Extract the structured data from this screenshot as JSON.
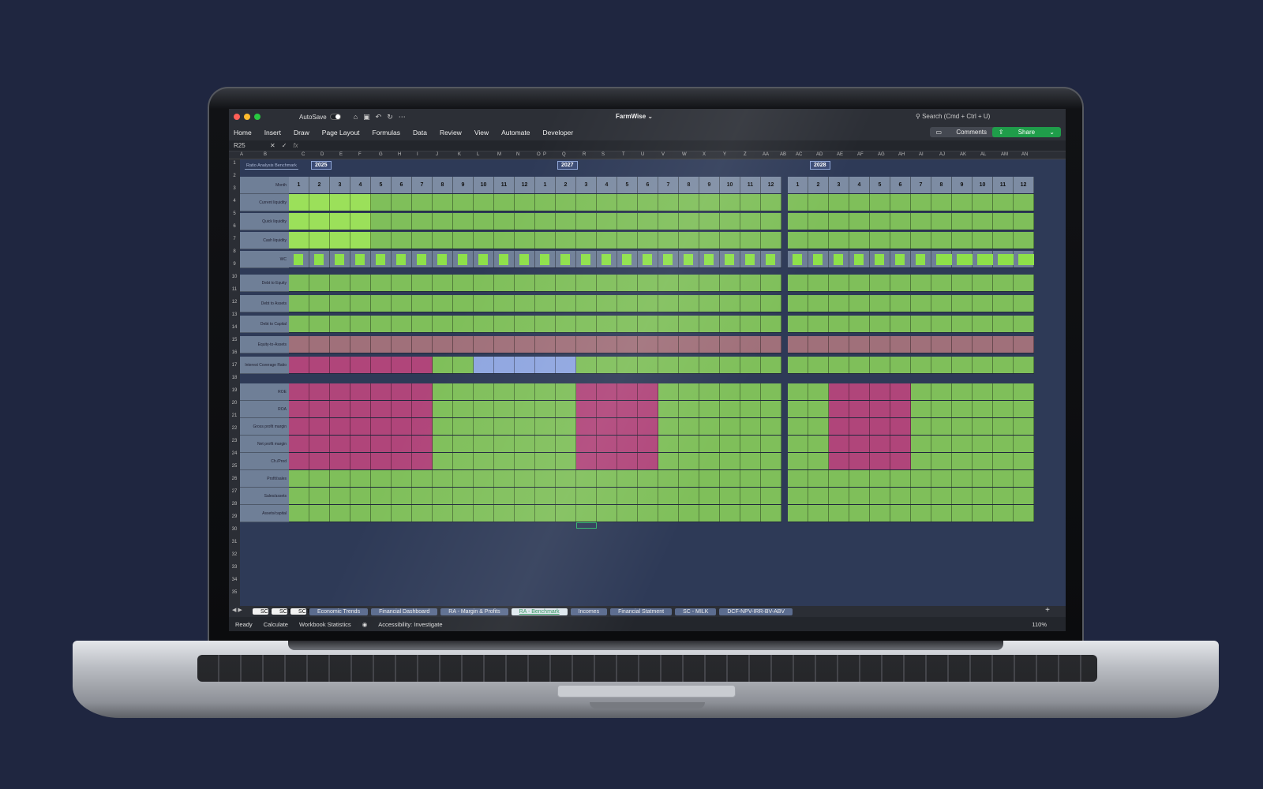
{
  "app": {
    "autosave_label": "AutoSave",
    "title": "FarmWise",
    "search": "Search (Cmd + Ctrl + U)"
  },
  "ribbon": {
    "tabs": [
      "Home",
      "Insert",
      "Draw",
      "Page Layout",
      "Formulas",
      "Data",
      "Review",
      "View",
      "Automate",
      "Developer"
    ],
    "comments": "Comments",
    "share": "Share"
  },
  "formula_bar": {
    "cell_ref": "R25",
    "fx": "fx"
  },
  "columns": [
    "A",
    "B",
    "C",
    "D",
    "E",
    "F",
    "G",
    "H",
    "I",
    "J",
    "K",
    "L",
    "M",
    "N",
    "O",
    "P",
    "Q",
    "R",
    "S",
    "T",
    "U",
    "V",
    "W",
    "X",
    "Y",
    "Z",
    "AA",
    "AB",
    "AC",
    "AD",
    "AE",
    "AF",
    "AG",
    "AH",
    "AI",
    "AJ",
    "AK",
    "AL",
    "AM",
    "AN"
  ],
  "rows": [
    "1",
    "2",
    "3",
    "4",
    "5",
    "6",
    "7",
    "8",
    "9",
    "10",
    "11",
    "12",
    "13",
    "14",
    "15",
    "16",
    "17",
    "18",
    "19",
    "20",
    "21",
    "22",
    "23",
    "24",
    "25",
    "26",
    "27",
    "28",
    "29",
    "30",
    "31",
    "32",
    "33",
    "34",
    "35"
  ],
  "sheet": {
    "title": "Ratio Analysis Benchmark",
    "years": [
      "2025",
      "2027",
      "2028"
    ],
    "month_label": "Month",
    "months": [
      "1",
      "2",
      "3",
      "4",
      "5",
      "6",
      "7",
      "8",
      "9",
      "10",
      "11",
      "12"
    ],
    "labels": [
      "Current liquidity",
      "Quick liquidity",
      "Cash liquidity",
      "WC",
      "Debt to Equity",
      "Debt to Assets",
      "Debt to Capital",
      "Equity-to-Assets",
      "Interest Coverage Ratio",
      "ROE",
      "ROA",
      "Gross profit margin",
      "Net profit margin",
      "Ch./Prod",
      "Profit/sales",
      "Sales/assets",
      "Assets/capital"
    ]
  },
  "tabs": [
    "SC - Milk - TC",
    "SC - Milk - TC Benchmark",
    "SC - Milk Production",
    "Economic Trends",
    "Financial Dashboard",
    "RA - Margin & Profits",
    "RA - Benchmark",
    "Incomes",
    "Financial Statment",
    "SC - MILK",
    "DCF-NPV-IRR-BV-ABV"
  ],
  "status": {
    "ready": "Ready",
    "calculate": "Calculate",
    "stats": "Workbook Statistics",
    "access": "Accessibility: Investigate",
    "zoom": "110%"
  },
  "colors": {
    "green": "#7fbf5a",
    "bright_green": "#9be05a",
    "magenta": "#b0457a",
    "rose": "#a0707a",
    "blue": "#8fa6e0",
    "slate": "#6f7f97"
  }
}
